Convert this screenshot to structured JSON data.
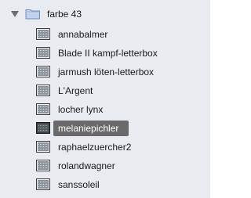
{
  "group": {
    "label": "farbe 43",
    "expanded": true,
    "folder_icon": "folder-icon",
    "disclosure_icon": "disclosure-triangle-down-icon"
  },
  "items": [
    {
      "label": "annabalmer",
      "icon": "sequence-icon",
      "selected": false
    },
    {
      "label": "Blade II kampf-letterbox",
      "icon": "sequence-icon",
      "selected": false
    },
    {
      "label": "jarmush löten-letterbox",
      "icon": "sequence-icon",
      "selected": false
    },
    {
      "label": "L'Argent",
      "icon": "sequence-icon",
      "selected": false
    },
    {
      "label": "locher lynx",
      "icon": "sequence-icon",
      "selected": false
    },
    {
      "label": "melaniepichler",
      "icon": "sequence-icon",
      "selected": true
    },
    {
      "label": "raphaelzuercher2",
      "icon": "sequence-icon",
      "selected": false
    },
    {
      "label": "rolandwagner",
      "icon": "sequence-icon",
      "selected": false
    },
    {
      "label": "sanssoleil",
      "icon": "sequence-icon",
      "selected": false
    }
  ],
  "colors": {
    "background": "#e8ebf0",
    "selection": "#6a6a6a",
    "folder_fill": "#bfd3ec",
    "folder_stroke": "#6f8fb8"
  }
}
